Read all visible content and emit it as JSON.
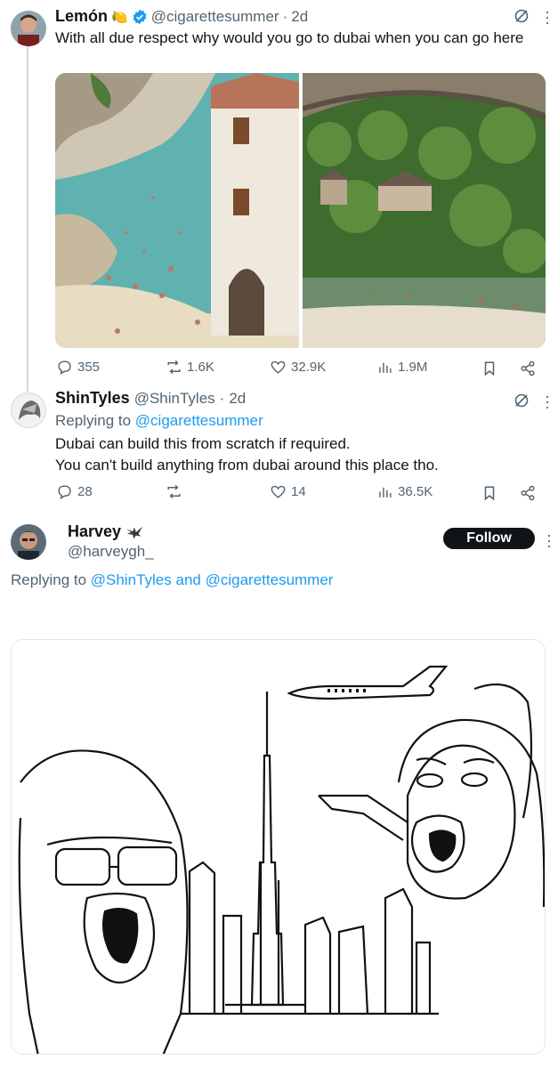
{
  "tweet1": {
    "name": "Lemón",
    "name_emoji": "🍋",
    "handle": "@cigarettesummer",
    "sep": "·",
    "time": "2d",
    "text": "With all due respect why would you go to dubai when you can go here",
    "stats": {
      "replies": "355",
      "reposts": "1.6K",
      "likes": "32.9K",
      "views": "1.9M"
    }
  },
  "tweet2": {
    "name": "ShinTyles",
    "handle": "@ShinTyles",
    "sep": "·",
    "time": "2d",
    "replying_prefix": "Replying to",
    "replying_to": "@cigarettesummer",
    "line1": "Dubai can build this from scratch if required.",
    "line2": "You can't build anything from dubai around this place tho.",
    "stats": {
      "replies": "28",
      "reposts": "",
      "likes": "14",
      "views": "36.5K"
    }
  },
  "tweet3": {
    "name": "Harvey",
    "handle": "@harveygh_",
    "follow_label": "Follow",
    "replying_prefix": "Replying to",
    "replying_user1": "@ShinTyles",
    "replying_and": "and",
    "replying_user2": "@cigarettesummer"
  },
  "colors": {
    "link": "#1d9bf0",
    "muted": "#536471",
    "verified": "#1d9bf0",
    "follow_bg": "#0f1419"
  }
}
